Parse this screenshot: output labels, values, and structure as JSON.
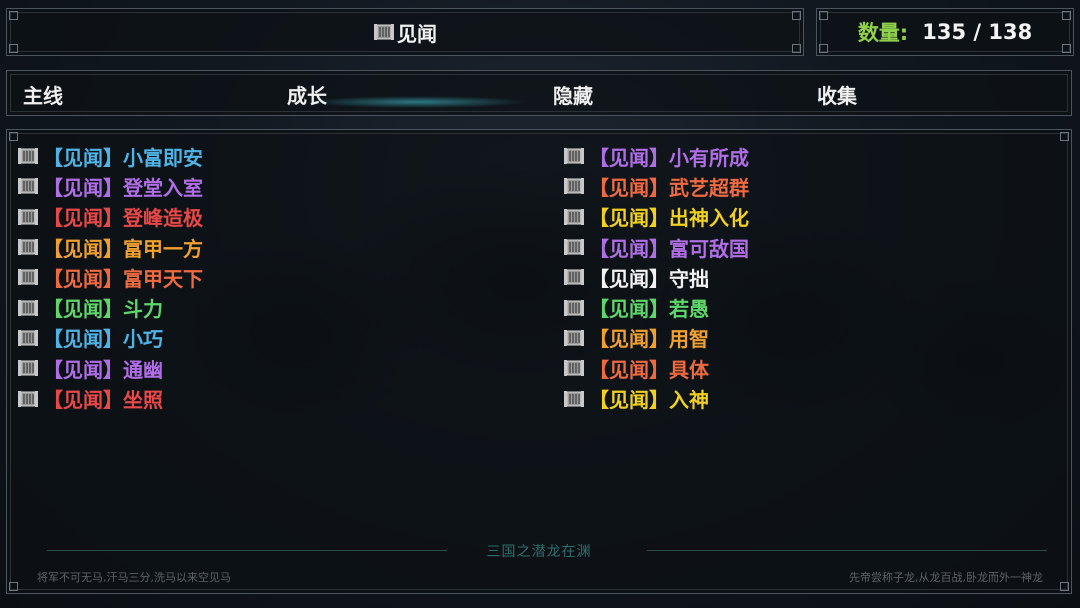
{
  "header": {
    "title": "见闻",
    "count_label": "数量:",
    "count_value": "135 / 138"
  },
  "tabs": [
    {
      "label": "主线",
      "active": false
    },
    {
      "label": "成长",
      "active": true
    },
    {
      "label": "隐藏",
      "active": false
    },
    {
      "label": "收集",
      "active": false
    }
  ],
  "entries_left": [
    {
      "tag": "【见闻】",
      "name": "小富即安",
      "color": "#4fb3e6"
    },
    {
      "tag": "【见闻】",
      "name": "登堂入室",
      "color": "#b06ee6"
    },
    {
      "tag": "【见闻】",
      "name": "登峰造极",
      "color": "#e84848"
    },
    {
      "tag": "【见闻】",
      "name": "富甲一方",
      "color": "#f0a030"
    },
    {
      "tag": "【见闻】",
      "name": "富甲天下",
      "color": "#ef6a40"
    },
    {
      "tag": "【见闻】",
      "name": "斗力",
      "color": "#5fd66a"
    },
    {
      "tag": "【见闻】",
      "name": "小巧",
      "color": "#4fb3e6"
    },
    {
      "tag": "【见闻】",
      "name": "通幽",
      "color": "#b06ee6"
    },
    {
      "tag": "【见闻】",
      "name": "坐照",
      "color": "#e84848"
    }
  ],
  "entries_right": [
    {
      "tag": "【见闻】",
      "name": "小有所成",
      "color": "#b06ee6"
    },
    {
      "tag": "【见闻】",
      "name": "武艺超群",
      "color": "#ef6a40"
    },
    {
      "tag": "【见闻】",
      "name": "出神入化",
      "color": "#f0d020"
    },
    {
      "tag": "【见闻】",
      "name": "富可敌国",
      "color": "#b06ee6"
    },
    {
      "tag": "【见闻】",
      "name": "守拙",
      "color": "#f2f2f2"
    },
    {
      "tag": "【见闻】",
      "name": "若愚",
      "color": "#5fd66a"
    },
    {
      "tag": "【见闻】",
      "name": "用智",
      "color": "#f0a030"
    },
    {
      "tag": "【见闻】",
      "name": "具体",
      "color": "#ef6a40"
    },
    {
      "tag": "【见闻】",
      "name": "入神",
      "color": "#f0d020"
    }
  ],
  "footer": {
    "center": "三国之潜龙在渊",
    "left_quote": "将军不可无马,汗马三分,洗马以来空见马",
    "right_quote": "先帝尝称子龙,从龙百战,卧龙而外一神龙"
  },
  "icons": {
    "entry_icon": "scroll-icon"
  }
}
